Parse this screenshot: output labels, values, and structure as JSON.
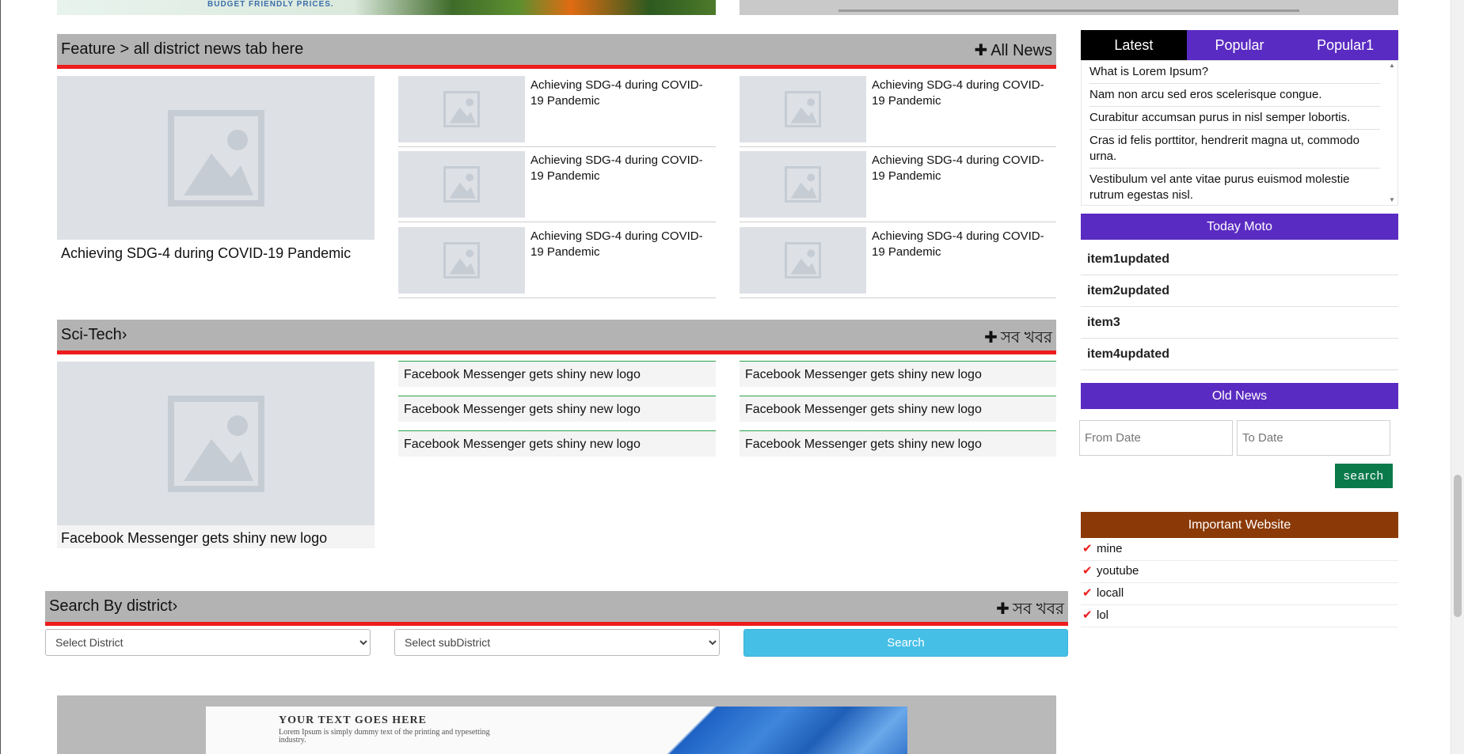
{
  "top_banner": {
    "tagline": "BUDGET FRIENDLY PRICES."
  },
  "feature": {
    "title": "Feature > all district news tab here",
    "all_label": "All News",
    "main_caption": "Achieving SDG-4 during COVID-19 Pandemic",
    "items": [
      "Achieving SDG-4 during COVID-19 Pandemic",
      "Achieving SDG-4 during COVID-19 Pandemic",
      "Achieving SDG-4 during COVID-19 Pandemic",
      "Achieving SDG-4 during COVID-19 Pandemic",
      "Achieving SDG-4 during COVID-19 Pandemic",
      "Achieving SDG-4 during COVID-19 Pandemic"
    ]
  },
  "scitech": {
    "title": "Sci-Tech›",
    "all_label": "সব খবর",
    "main_caption": "Facebook Messenger gets shiny new logo",
    "items": [
      "Facebook Messenger gets shiny new logo",
      "Facebook Messenger gets shiny new logo",
      "Facebook Messenger gets shiny new logo",
      "Facebook Messenger gets shiny new logo",
      "Facebook Messenger gets shiny new logo",
      "Facebook Messenger gets shiny new logo"
    ]
  },
  "district": {
    "title": "Search By district›",
    "all_label": "সব খবর",
    "district_placeholder": "Select District",
    "subdistrict_placeholder": "Select subDistrict",
    "search_label": "Search"
  },
  "sidebar": {
    "tabs": [
      "Latest",
      "Popular",
      "Popular1"
    ],
    "latest": [
      "What is Lorem Ipsum?",
      "Nam non arcu sed eros scelerisque congue.",
      "Curabitur accumsan purus in nisl semper lobortis.",
      "Cras id felis porttitor, hendrerit magna ut, commodo urna.",
      "Vestibulum vel ante vitae purus euismod molestie rutrum egestas nisl."
    ],
    "moto_title": "Today Moto",
    "moto_items": [
      "item1updated",
      "item2updated",
      "item3",
      "item4updated"
    ],
    "old_news_title": "Old News",
    "from_placeholder": "From Date",
    "to_placeholder": "To Date",
    "search_label": "search",
    "important_title": "Important Website",
    "important_items": [
      "mine",
      "youtube",
      "locall",
      "lol"
    ]
  },
  "bottom_banner": {
    "heading": "YOUR TEXT GOES HERE",
    "body": "Lorem Ipsum is simply dummy text of the printing and typesetting industry."
  },
  "colors": {
    "header_gray": "#b3b3b3",
    "accent_red": "#ee1c1c",
    "purple": "#5a2bc2",
    "brown": "#8b3a07",
    "green_btn": "#0a7a4a",
    "blue_btn": "#46bfe6"
  }
}
